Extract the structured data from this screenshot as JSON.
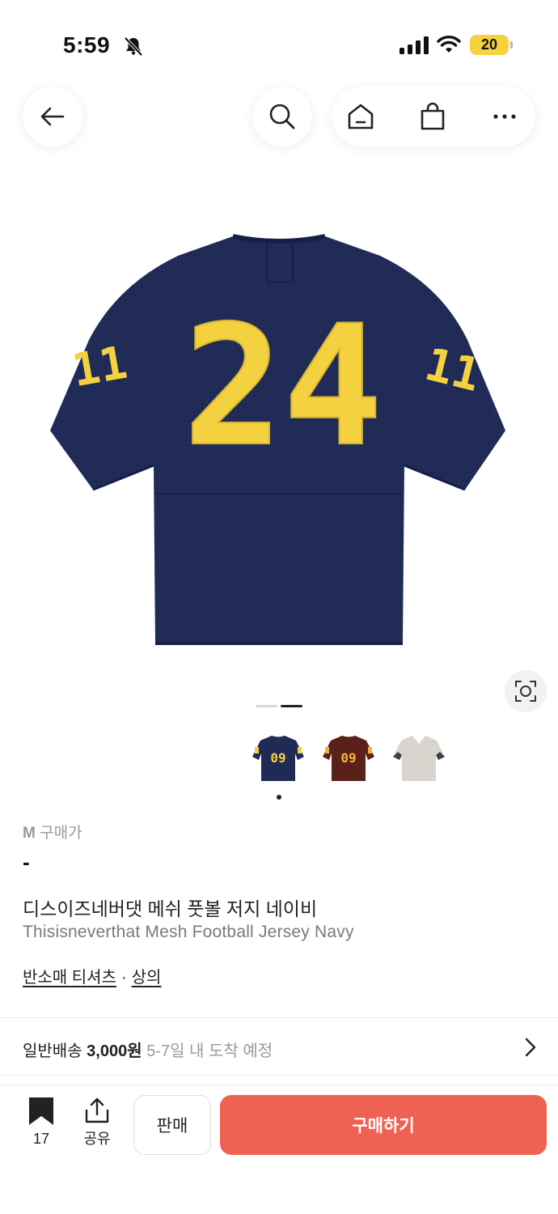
{
  "status_bar": {
    "time": "5:59",
    "battery": "20"
  },
  "colors": {
    "buy_accent": "#ef6253",
    "battery": "#f6d23f",
    "jersey_navy": "#1f2a55",
    "number_gold": "#f3d13f"
  },
  "nav": {
    "back_icon": "arrow-left-icon",
    "search_icon": "search-icon",
    "home_icon": "home-icon",
    "bag_icon": "shopping-bag-icon",
    "more_icon": "more-horizontal-icon"
  },
  "hero": {
    "number": "24",
    "sleeve_number": "11",
    "pager": {
      "count": 2,
      "active_index": 1
    }
  },
  "thumbnails": [
    {
      "number": "09",
      "color": "navy",
      "selected": true
    },
    {
      "number": "09",
      "color": "brown",
      "selected": false
    },
    {
      "number": "",
      "color": "grey",
      "selected": false
    }
  ],
  "product": {
    "size": "M",
    "price_label": "구매가",
    "price_value": "-",
    "title_ko": "디스이즈네버댓 메쉬 풋볼 저지 네이비",
    "title_en": "Thisisneverthat Mesh Football Jersey Navy",
    "category_1": "반소매 티셔츠",
    "category_sep": "·",
    "category_2": "상의"
  },
  "shipping": {
    "label": "일반배송",
    "price": "3,000원",
    "eta": "5-7일 내 도착 예정"
  },
  "bottom_bar": {
    "bookmark_count": "17",
    "share_label": "공유",
    "sell_label": "판매",
    "buy_label": "구매하기"
  }
}
